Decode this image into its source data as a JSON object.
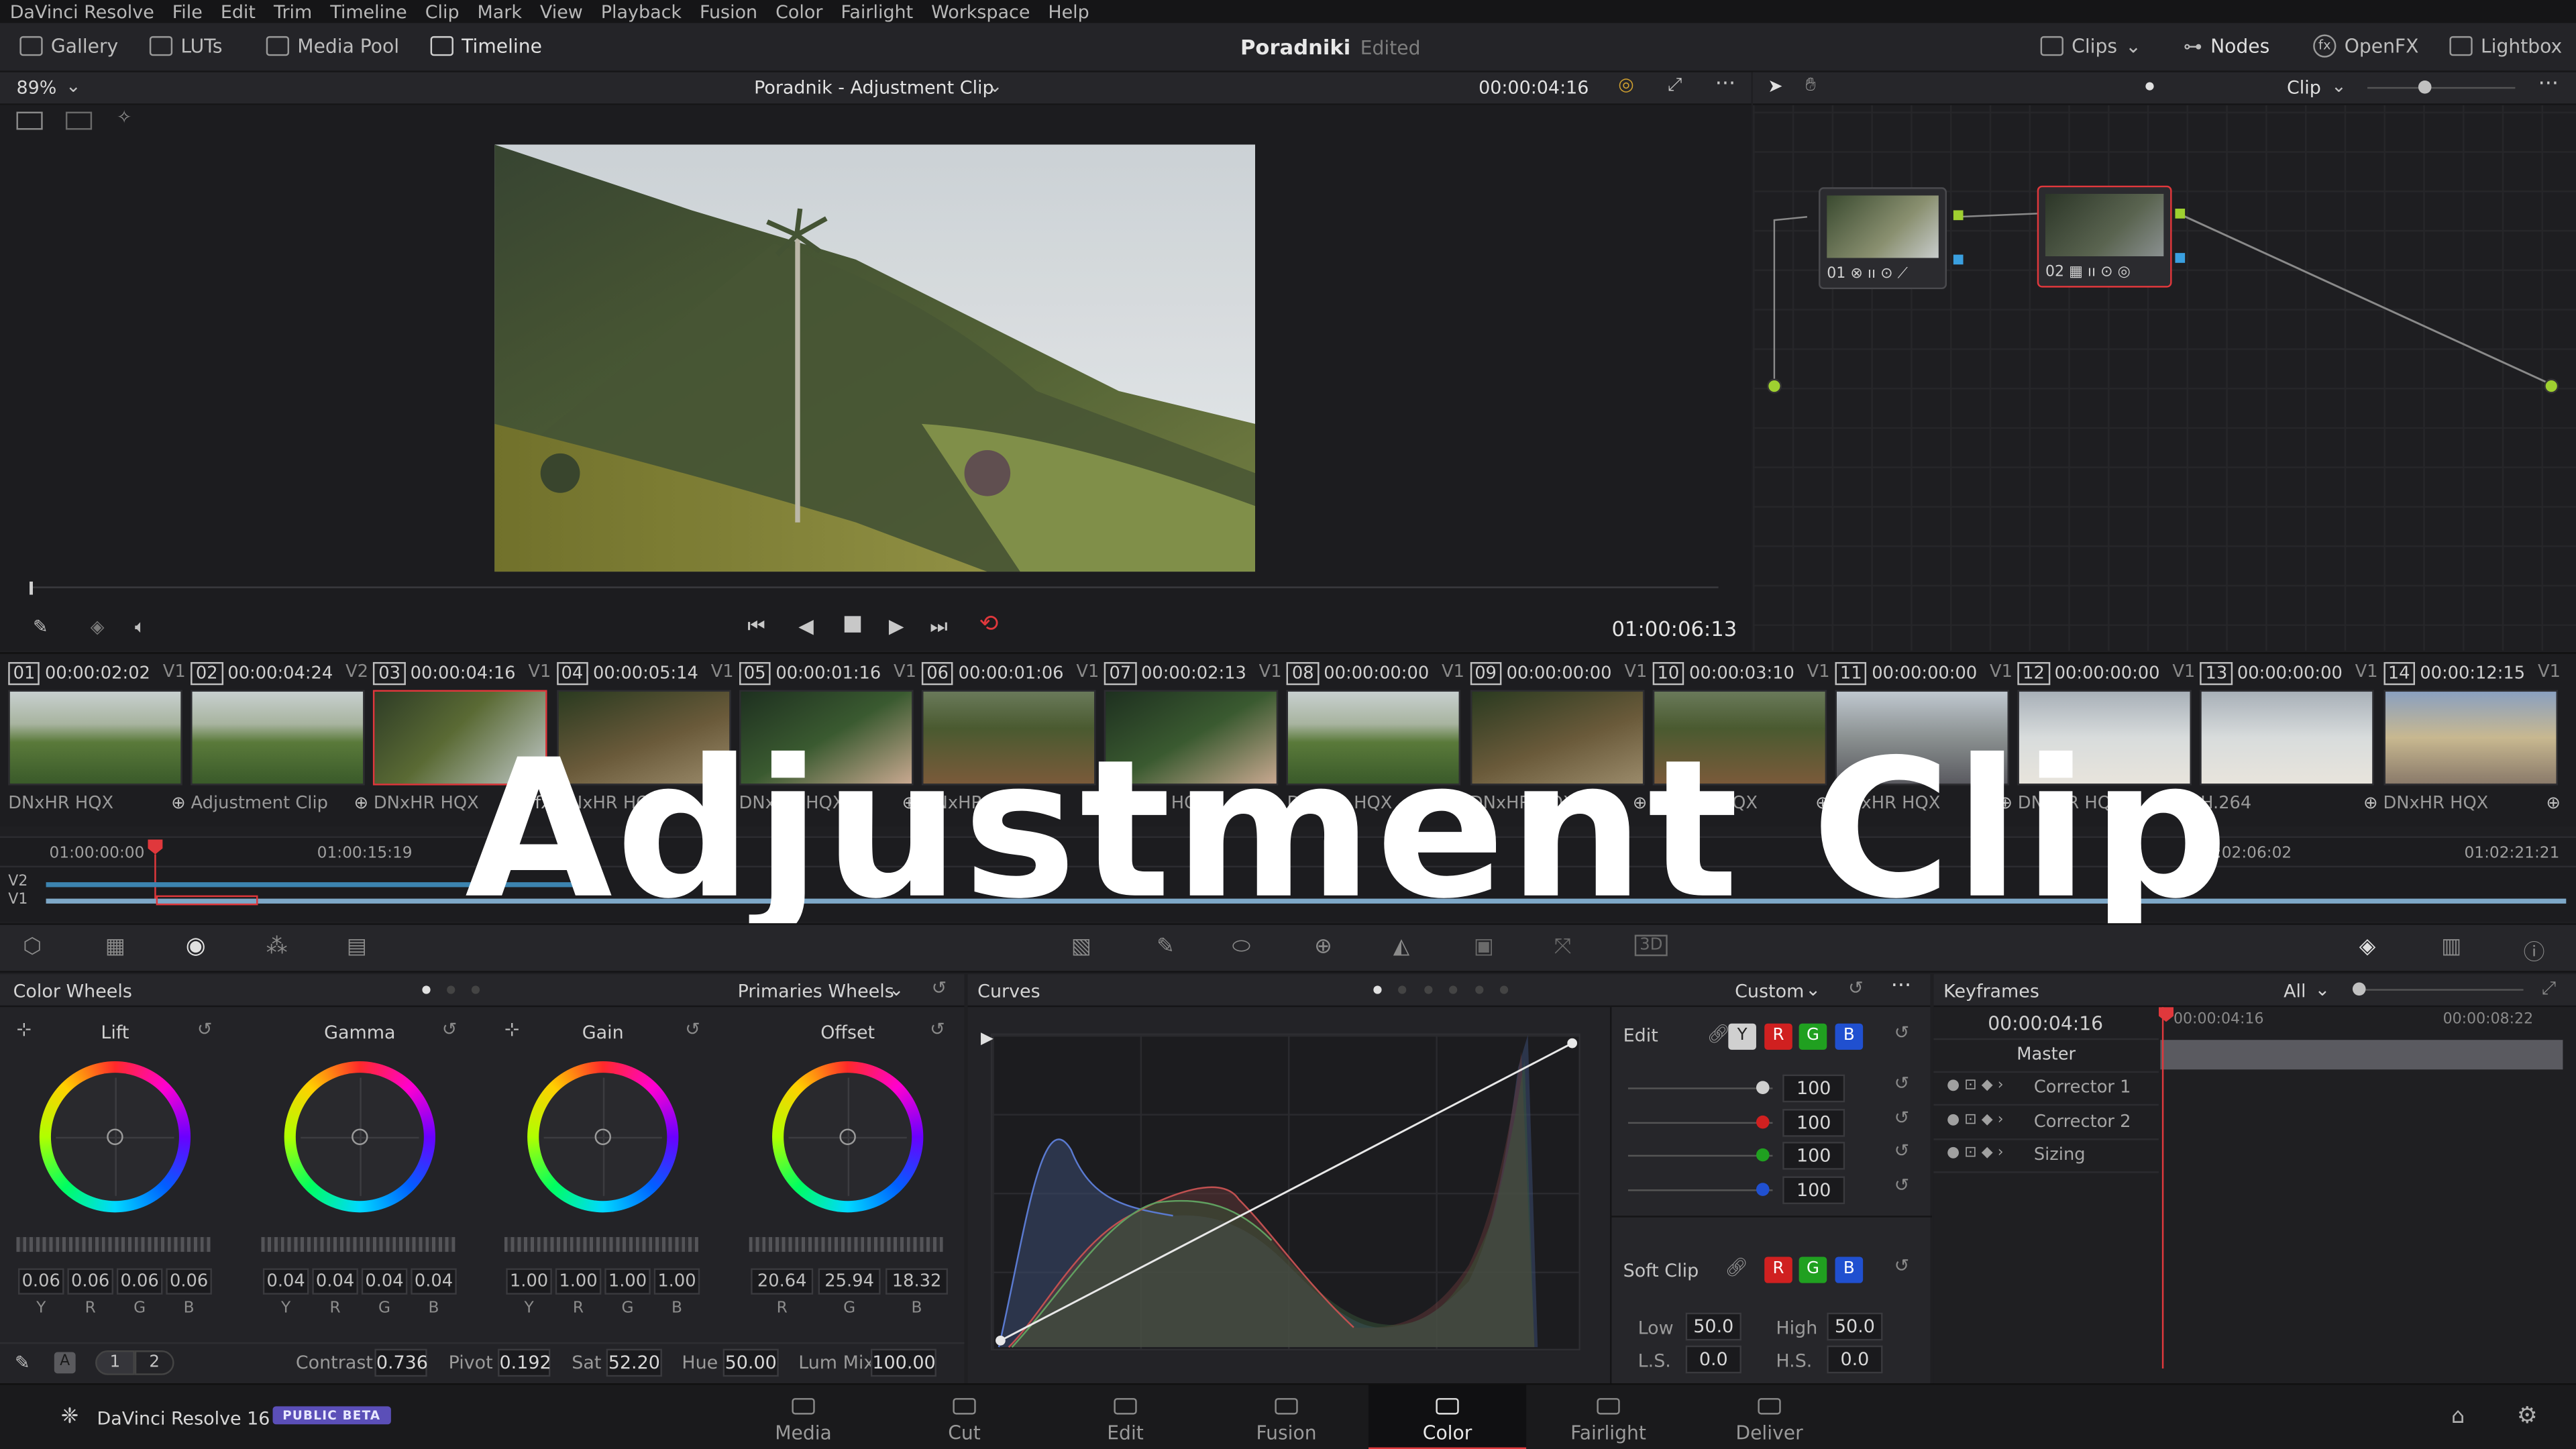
{
  "menu": [
    "DaVinci Resolve",
    "File",
    "Edit",
    "Trim",
    "Timeline",
    "Clip",
    "Mark",
    "View",
    "Playback",
    "Fusion",
    "Color",
    "Fairlight",
    "Workspace",
    "Help"
  ],
  "toolbar": {
    "gallery": "Gallery",
    "luts": "LUTs",
    "media_pool": "Media Pool",
    "timeline": "Timeline",
    "project_name": "Poradniki",
    "project_status": "Edited",
    "clips": "Clips",
    "nodes": "Nodes",
    "openfx": "OpenFX",
    "lightbox": "Lightbox"
  },
  "viewer": {
    "zoom": "89%",
    "title": "Poradnik - Adjustment Clip",
    "timecode": "00:00:04:16",
    "playhead_tc": "01:00:06:13"
  },
  "nodes": {
    "mode": "Clip",
    "node1_label": "01",
    "node2_label": "02"
  },
  "clips": [
    {
      "num": "01",
      "tc": "00:00:02:02",
      "track": "V1",
      "codec": "DNxHR HQX",
      "scene": "hills"
    },
    {
      "num": "02",
      "tc": "00:00:04:24",
      "track": "V2",
      "codec": "Adjustment Clip",
      "scene": "hills"
    },
    {
      "num": "03",
      "tc": "00:00:04:16",
      "track": "V1",
      "codec": "DNxHR HQX",
      "scene": "palm",
      "selected": true
    },
    {
      "num": "04",
      "tc": "00:00:05:14",
      "track": "V1",
      "codec": "DNxHR HQX",
      "scene": "farm"
    },
    {
      "num": "05",
      "tc": "00:00:01:16",
      "track": "V1",
      "codec": "DNxHR HQX",
      "scene": "plants"
    },
    {
      "num": "06",
      "tc": "00:00:01:06",
      "track": "V1",
      "codec": "DNxHR HQX",
      "scene": "field"
    },
    {
      "num": "07",
      "tc": "00:00:02:13",
      "track": "V1",
      "codec": "DNxHR HQX",
      "scene": "plants"
    },
    {
      "num": "08",
      "tc": "00:00:00:00",
      "track": "V1",
      "codec": "DNxHR HQX",
      "scene": "hills"
    },
    {
      "num": "09",
      "tc": "00:00:00:00",
      "track": "V1",
      "codec": "DNxHR HQX",
      "scene": "farm"
    },
    {
      "num": "10",
      "tc": "00:00:03:10",
      "track": "V1",
      "codec": "DNxHR HQX",
      "scene": "field"
    },
    {
      "num": "11",
      "tc": "00:00:00:00",
      "track": "V1",
      "codec": "DNxHR HQX",
      "scene": "street"
    },
    {
      "num": "12",
      "tc": "00:00:00:00",
      "track": "V1",
      "codec": "DNxHR HQX",
      "scene": "salt"
    },
    {
      "num": "13",
      "tc": "00:00:00:00",
      "track": "V1",
      "codec": "H.264",
      "scene": "salt"
    },
    {
      "num": "14",
      "tc": "00:00:12:15",
      "track": "V1",
      "codec": "DNxHR HQX",
      "scene": "square"
    }
  ],
  "timeline_ruler": [
    "01:00:00:00",
    "01:00:15:19",
    "01:02:06:02",
    "01:02:21:21"
  ],
  "tracks": [
    "V2",
    "V1"
  ],
  "overlay_title": "Adjustment Clip",
  "color_wheels": {
    "title": "Color Wheels",
    "mode": "Primaries Wheels",
    "wheels": [
      {
        "name": "Lift",
        "values": [
          "0.06",
          "0.06",
          "0.06",
          "0.06"
        ],
        "channels": [
          "Y",
          "R",
          "G",
          "B"
        ]
      },
      {
        "name": "Gamma",
        "values": [
          "0.04",
          "0.04",
          "0.04",
          "0.04"
        ],
        "channels": [
          "Y",
          "R",
          "G",
          "B"
        ]
      },
      {
        "name": "Gain",
        "values": [
          "1.00",
          "1.00",
          "1.00",
          "1.00"
        ],
        "channels": [
          "Y",
          "R",
          "G",
          "B"
        ]
      },
      {
        "name": "Offset",
        "values": [
          "20.64",
          "25.94",
          "18.32"
        ],
        "channels": [
          "R",
          "G",
          "B"
        ]
      }
    ],
    "page1": "1",
    "page2": "2",
    "contrast_label": "Contrast",
    "contrast": "0.736",
    "pivot_label": "Pivot",
    "pivot": "0.192",
    "sat_label": "Sat",
    "sat": "52.20",
    "hue_label": "Hue",
    "hue": "50.00",
    "lummix_label": "Lum Mix",
    "lummix": "100.00"
  },
  "curves": {
    "title": "Curves",
    "mode": "Custom",
    "edit_label": "Edit",
    "channels": [
      "Y",
      "R",
      "G",
      "B"
    ],
    "intensity": [
      "100",
      "100",
      "100",
      "100"
    ],
    "softclip_label": "Soft Clip",
    "low_label": "Low",
    "low": "50.0",
    "high_label": "High",
    "high": "50.0",
    "ls_label": "L.S.",
    "ls": "0.0",
    "hs_label": "H.S.",
    "hs": "0.0"
  },
  "keyframes": {
    "title": "Keyframes",
    "filter": "All",
    "tc_current": "00:00:04:16",
    "tc_start": "00:00:04:16",
    "tc_end": "00:00:08:22",
    "rows": [
      "Master",
      "Corrector 1",
      "Corrector 2",
      "Sizing"
    ]
  },
  "bottom": {
    "app": "DaVinci Resolve 16",
    "badge": "PUBLIC BETA",
    "pages": [
      "Media",
      "Cut",
      "Edit",
      "Fusion",
      "Color",
      "Fairlight",
      "Deliver"
    ],
    "active_page": "Color"
  },
  "colors": {
    "accent": "#e0383c",
    "badge": "#5b4fb8"
  }
}
